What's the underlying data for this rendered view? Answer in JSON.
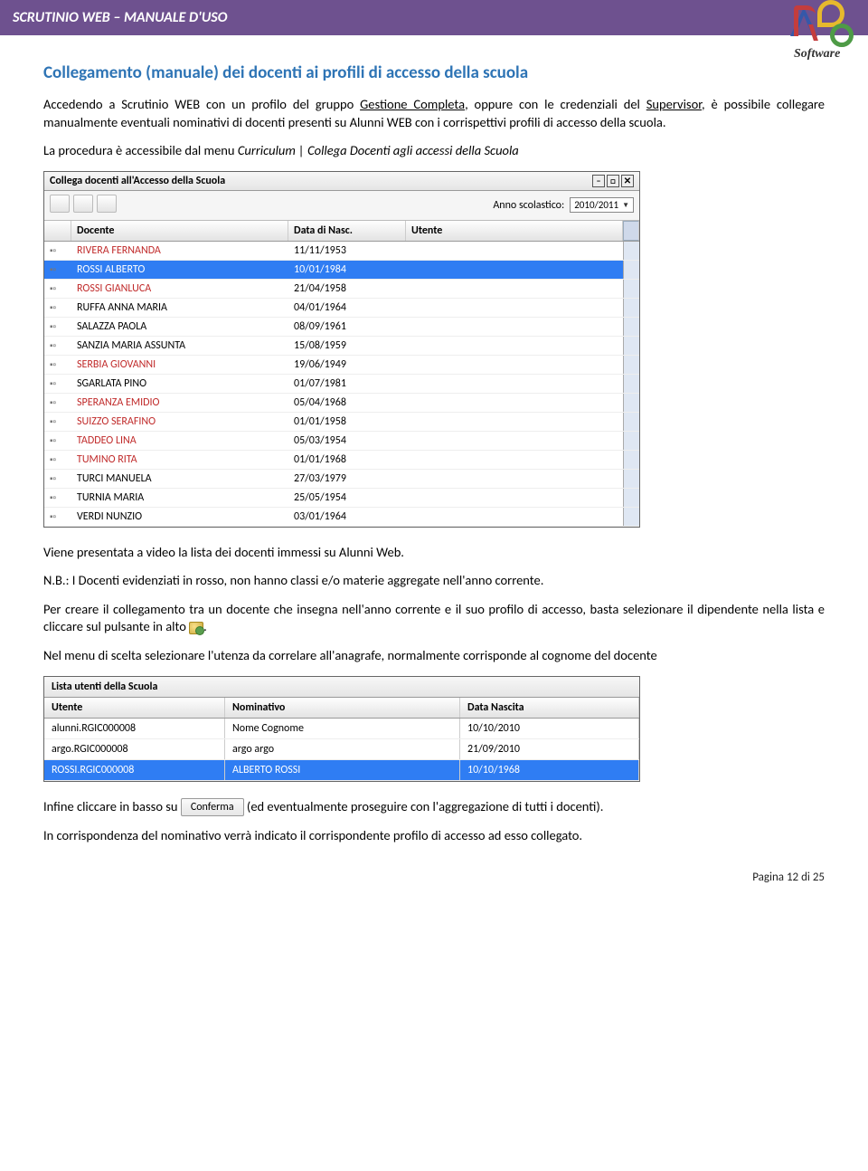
{
  "header": {
    "title": "SCRUTINIO WEB – MANUALE D'USO",
    "logo_text": "Software"
  },
  "section_title": "Collegamento (manuale) dei docenti ai profili di accesso della scuola",
  "p1_a": "Accedendo a Scrutinio WEB con un profilo del gruppo ",
  "p1_link": "Gestione Completa",
  "p1_b": ", oppure con le credenziali del ",
  "p1_sup": "Supervisor",
  "p1_c": ", è possibile collegare manualmente eventuali nominativi di docenti presenti su Alunni WEB con i corrispettivi profili di accesso della scuola.",
  "p2_a": "La procedura è accessibile dal menu ",
  "p2_i": "Curriculum | Collega Docenti agli accessi della Scuola",
  "win": {
    "title": "Collega docenti all'Accesso della Scuola",
    "anno_label": "Anno scolastico:",
    "anno_value": "2010/2011",
    "cols": {
      "docente": "Docente",
      "data": "Data di Nasc.",
      "utente": "Utente"
    },
    "rows": [
      {
        "n": "RIVERA FERNANDA",
        "d": "11/11/1953",
        "red": true
      },
      {
        "n": "ROSSI ALBERTO",
        "d": "10/01/1984",
        "sel": true
      },
      {
        "n": "ROSSI GIANLUCA",
        "d": "21/04/1958",
        "red": true
      },
      {
        "n": "RUFFA ANNA MARIA",
        "d": "04/01/1964"
      },
      {
        "n": "SALAZZA PAOLA",
        "d": "08/09/1961"
      },
      {
        "n": "SANZIA MARIA ASSUNTA",
        "d": "15/08/1959"
      },
      {
        "n": "SERBIA GIOVANNI",
        "d": "19/06/1949",
        "red": true
      },
      {
        "n": "SGARLATA PINO",
        "d": "01/07/1981"
      },
      {
        "n": "SPERANZA EMIDIO",
        "d": "05/04/1968",
        "red": true
      },
      {
        "n": "SUIZZO SERAFINO",
        "d": "01/01/1958",
        "red": true
      },
      {
        "n": "TADDEO LINA",
        "d": "05/03/1954",
        "red": true
      },
      {
        "n": "TUMINO RITA",
        "d": "01/01/1968",
        "red": true
      },
      {
        "n": "TURCI MANUELA",
        "d": "27/03/1979"
      },
      {
        "n": "TURNIA MARIA",
        "d": "25/05/1954"
      },
      {
        "n": "VERDI NUNZIO",
        "d": "03/01/1964"
      }
    ]
  },
  "p3": "Viene presentata a video la lista dei docenti immessi su Alunni Web.",
  "p4": "N.B.: I Docenti evidenziati in rosso, non hanno classi e/o materie aggregate nell'anno corrente.",
  "p5_a": "Per creare il collegamento tra un docente che insegna nell'anno corrente e il suo profilo di accesso, basta selezionare il dipendente nella lista e cliccare sul pulsante in alto ",
  "p5_b": ".",
  "p6": "Nel menu di scelta selezionare l'utenza da correlare all'anagrafe, normalmente corrisponde al cognome del docente",
  "fig2": {
    "title": "Lista utenti della Scuola",
    "cols": {
      "utente": "Utente",
      "nom": "Nominativo",
      "data": "Data Nascita"
    },
    "rows": [
      {
        "u": "alunni.RGIC000008",
        "n": "Nome Cognome",
        "d": "10/10/2010"
      },
      {
        "u": "argo.RGIC000008",
        "n": "argo argo",
        "d": "21/09/2010"
      },
      {
        "u": "ROSSI.RGIC000008",
        "n": "ALBERTO ROSSI",
        "d": "10/10/1968",
        "sel": true
      }
    ]
  },
  "p7_a": "Infine cliccare in basso su ",
  "p7_btn": "Conferma",
  "p7_b": " (ed eventualmente proseguire con l'aggregazione di tutti i docenti).",
  "p8": "In corrispondenza del nominativo verrà indicato il corrispondente profilo di accesso ad esso collegato.",
  "footer": "Pagina 12 di 25"
}
